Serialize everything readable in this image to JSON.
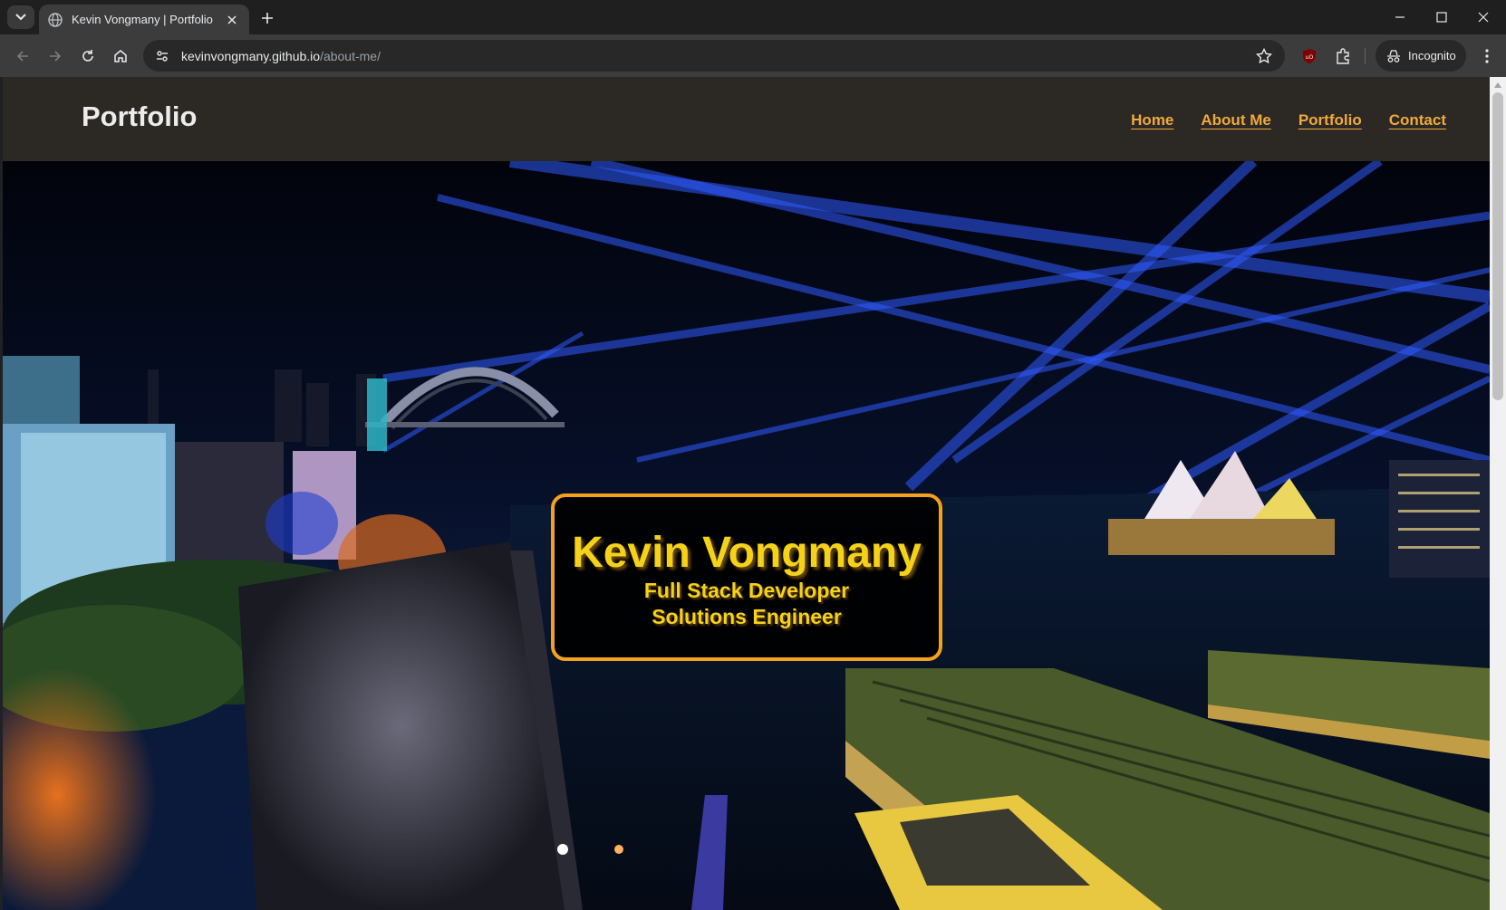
{
  "browser": {
    "tab": {
      "title": "Kevin Vongmany | Portfolio"
    },
    "address": {
      "host": "kevinvongmany.github.io",
      "path": "/about-me/"
    },
    "profile_label": "Incognito",
    "icons": [
      "tab-search-icon",
      "globe-icon",
      "close-icon",
      "plus-icon",
      "minimize-icon",
      "maximize-icon",
      "close-window-icon",
      "back-icon",
      "forward-icon",
      "reload-icon",
      "home-icon",
      "site-info-icon",
      "star-icon",
      "ublock-icon",
      "extensions-icon",
      "incognito-icon",
      "more-menu-icon"
    ]
  },
  "site": {
    "brand": "Portfolio",
    "nav": [
      {
        "label": "Home"
      },
      {
        "label": "About Me"
      },
      {
        "label": "Portfolio"
      },
      {
        "label": "Contact"
      }
    ],
    "hero": {
      "name": "Kevin Vongmany",
      "role_1": "Full Stack Developer",
      "role_2": "Solutions Engineer"
    }
  },
  "colors": {
    "accent": "#f0a93c",
    "card_border": "#f5a11c",
    "card_text": "#f5d21a",
    "header_bg": "#2c2924"
  }
}
